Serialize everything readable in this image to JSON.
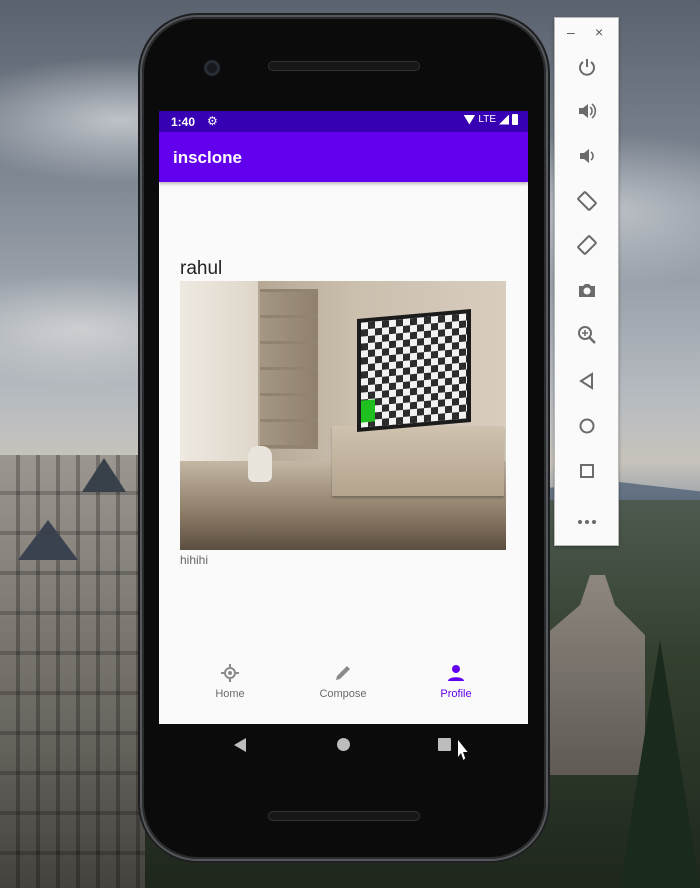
{
  "status_bar": {
    "time": "1:40",
    "network": "LTE"
  },
  "app_bar": {
    "title": "insclone"
  },
  "post": {
    "username": "rahul",
    "caption": "hihihi"
  },
  "bottom_nav": {
    "items": [
      {
        "label": "Home",
        "icon": "crosshair-icon",
        "active": false
      },
      {
        "label": "Compose",
        "icon": "pencil-icon",
        "active": false
      },
      {
        "label": "Profile",
        "icon": "person-icon",
        "active": true
      }
    ]
  },
  "emulator_toolbar": {
    "minimize": "–",
    "close": "×",
    "buttons": [
      {
        "name": "power",
        "glyph": "⏻"
      },
      {
        "name": "volume-up",
        "glyph": "🔊"
      },
      {
        "name": "volume-down",
        "glyph": "🔉"
      },
      {
        "name": "rotate-left",
        "glyph": "⟲"
      },
      {
        "name": "rotate-right",
        "glyph": "⟳"
      },
      {
        "name": "screenshot",
        "glyph": "📷"
      },
      {
        "name": "zoom",
        "glyph": "⊕"
      },
      {
        "name": "back",
        "glyph": "◁"
      },
      {
        "name": "home",
        "glyph": "○"
      },
      {
        "name": "overview",
        "glyph": "□"
      },
      {
        "name": "more",
        "glyph": "•••"
      }
    ]
  },
  "colors": {
    "primary": "#6200ee",
    "primary_dark": "#3700b3",
    "nav_inactive": "#6b6b6b"
  }
}
